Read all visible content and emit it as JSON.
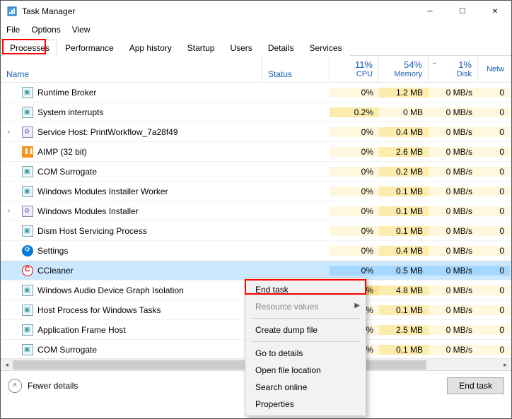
{
  "window": {
    "title": "Task Manager"
  },
  "menu": {
    "file": "File",
    "options": "Options",
    "view": "View"
  },
  "tabs": [
    "Processes",
    "Performance",
    "App history",
    "Startup",
    "Users",
    "Details",
    "Services"
  ],
  "columns": {
    "name": "Name",
    "status": "Status",
    "cpu_pct": "11%",
    "cpu": "CPU",
    "mem_pct": "54%",
    "mem": "Memory",
    "disk_pct": "1%",
    "disk": "Disk",
    "net": "Netw"
  },
  "rows": [
    {
      "exp": "",
      "icon": "generic",
      "name": "Runtime Broker",
      "cpu": "0%",
      "cpuHeat": 0,
      "mem": "1.2 MB",
      "memHeat": 1,
      "disk": "0 MB/s",
      "diskHeat": 0
    },
    {
      "exp": "",
      "icon": "generic",
      "name": "System interrupts",
      "cpu": "0.2%",
      "cpuHeat": 1,
      "mem": "0 MB",
      "memHeat": 0,
      "disk": "0 MB/s",
      "diskHeat": 0
    },
    {
      "exp": "›",
      "icon": "svc",
      "name": "Service Host: PrintWorkflow_7a28f49",
      "cpu": "0%",
      "cpuHeat": 0,
      "mem": "0.4 MB",
      "memHeat": 1,
      "disk": "0 MB/s",
      "diskHeat": 0
    },
    {
      "exp": "",
      "icon": "aimp",
      "name": "AIMP (32 bit)",
      "cpu": "0%",
      "cpuHeat": 0,
      "mem": "2.6 MB",
      "memHeat": 1,
      "disk": "0 MB/s",
      "diskHeat": 0
    },
    {
      "exp": "",
      "icon": "generic",
      "name": "COM Surrogate",
      "cpu": "0%",
      "cpuHeat": 0,
      "mem": "0.2 MB",
      "memHeat": 1,
      "disk": "0 MB/s",
      "diskHeat": 0
    },
    {
      "exp": "",
      "icon": "generic",
      "name": "Windows Modules Installer Worker",
      "cpu": "0%",
      "cpuHeat": 0,
      "mem": "0.1 MB",
      "memHeat": 1,
      "disk": "0 MB/s",
      "diskHeat": 0
    },
    {
      "exp": "›",
      "icon": "svc",
      "name": "Windows Modules Installer",
      "cpu": "0%",
      "cpuHeat": 0,
      "mem": "0.1 MB",
      "memHeat": 1,
      "disk": "0 MB/s",
      "diskHeat": 0
    },
    {
      "exp": "",
      "icon": "generic",
      "name": "Dism Host Servicing Process",
      "cpu": "0%",
      "cpuHeat": 0,
      "mem": "0.1 MB",
      "memHeat": 1,
      "disk": "0 MB/s",
      "diskHeat": 0
    },
    {
      "exp": "",
      "icon": "gear",
      "name": "Settings",
      "cpu": "0%",
      "cpuHeat": 0,
      "mem": "0.4 MB",
      "memHeat": 1,
      "disk": "0 MB/s",
      "diskHeat": 0
    },
    {
      "exp": "",
      "icon": "cc",
      "name": "CCleaner",
      "cpu": "0%",
      "cpuHeat": 0,
      "mem": "0.5 MB",
      "memHeat": 1,
      "disk": "0 MB/s",
      "diskHeat": 0,
      "sel": true
    },
    {
      "exp": "",
      "icon": "generic",
      "name": "Windows Audio Device Graph Isolation",
      "cpu": "3.3%",
      "cpuHeat": 2,
      "mem": "4.8 MB",
      "memHeat": 1,
      "disk": "0 MB/s",
      "diskHeat": 0
    },
    {
      "exp": "",
      "icon": "generic",
      "name": "Host Process for Windows Tasks",
      "cpu": "0%",
      "cpuHeat": 0,
      "mem": "0.1 MB",
      "memHeat": 1,
      "disk": "0 MB/s",
      "diskHeat": 0
    },
    {
      "exp": "",
      "icon": "generic",
      "name": "Application Frame Host",
      "cpu": "0%",
      "cpuHeat": 0,
      "mem": "2.5 MB",
      "memHeat": 1,
      "disk": "0 MB/s",
      "diskHeat": 0
    },
    {
      "exp": "",
      "icon": "generic",
      "name": "COM Surrogate",
      "cpu": "0%",
      "cpuHeat": 0,
      "mem": "0.1 MB",
      "memHeat": 1,
      "disk": "0 MB/s",
      "diskHeat": 0
    }
  ],
  "context": {
    "end_task": "End task",
    "resource_values": "Resource values",
    "create_dump": "Create dump file",
    "go_details": "Go to details",
    "open_loc": "Open file location",
    "search": "Search online",
    "properties": "Properties"
  },
  "footer": {
    "fewer": "Fewer details",
    "end_task": "End task"
  }
}
